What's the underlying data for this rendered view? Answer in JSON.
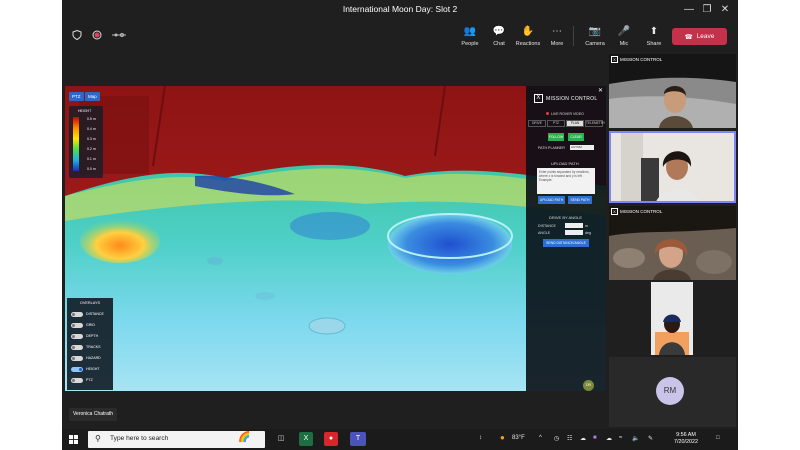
{
  "window": {
    "title": "International Moon Day: Slot 2"
  },
  "toolbar": {
    "left_icons": [
      "shield-icon",
      "record-icon",
      "connection-icon"
    ],
    "items": [
      {
        "label": "People",
        "icon": "people-icon"
      },
      {
        "label": "Chat",
        "icon": "chat-icon"
      },
      {
        "label": "Reactions",
        "icon": "reactions-icon"
      },
      {
        "label": "More",
        "icon": "more-icon"
      },
      {
        "label": "Camera",
        "icon": "camera-off-icon"
      },
      {
        "label": "Mic",
        "icon": "mic-off-icon"
      },
      {
        "label": "Share",
        "icon": "share-icon"
      }
    ],
    "leave_label": "Leave",
    "leave_color": "#c4314b"
  },
  "sim": {
    "chips": [
      "PTZ",
      "Map"
    ],
    "legend": {
      "title": "HEIGHT",
      "ticks": [
        "0.5 m",
        "0.4 m",
        "0.3 m",
        "0.2 m",
        "0.1 m",
        "0.0 m"
      ]
    },
    "overlays": {
      "title": "OVERLAYS",
      "items": [
        {
          "label": "DISTANCE",
          "on": false
        },
        {
          "label": "GRID",
          "on": false
        },
        {
          "label": "DEPTH",
          "on": false
        },
        {
          "label": "TRACKS",
          "on": false
        },
        {
          "label": "HAZARD",
          "on": false
        },
        {
          "label": "HEIGHT",
          "on": true
        },
        {
          "label": "PTZ",
          "on": false
        }
      ]
    },
    "mission_control": {
      "title": "MISSION CONTROL",
      "live": "LIVE ROVER VIDEO",
      "tabs": [
        "DRIVE",
        "PTZ",
        "PLAN",
        "TELEMETRY"
      ],
      "active_tab": "PLAN",
      "follow": "FOLLOW",
      "clear": "CLEAR",
      "path_planner_label": "PATH PLANNER",
      "path_planner_value": "AUTOM",
      "upload_path_title": "UPLOAD PATH",
      "upload_placeholder": "Enter points separated by newlines, where x is forward and y is left. Example:",
      "upload_path_btn": "UPLOAD PATH",
      "send_path_btn": "SEND PATH",
      "drive_by_angle_title": "DRIVE BY ANGLE",
      "distance_label": "DISTANCE",
      "angle_label": "ANGLE",
      "distance_unit": "m",
      "angle_unit": "deg",
      "send_da_btn": "SEND DISTANCE/ANGLE"
    },
    "dr_badge": "DR"
  },
  "presenter_name": "Veronica Chatrath",
  "participants": [
    {
      "tag": "MISSION CONTROL"
    },
    {
      "tag": ""
    },
    {
      "tag": "MISSION CONTROL"
    },
    {
      "tag": ""
    },
    {
      "initials": "RM"
    }
  ],
  "taskbar": {
    "search_placeholder": "Type here to search",
    "temperature": "83°F",
    "time": "9:56 AM",
    "date": "7/20/2022"
  }
}
